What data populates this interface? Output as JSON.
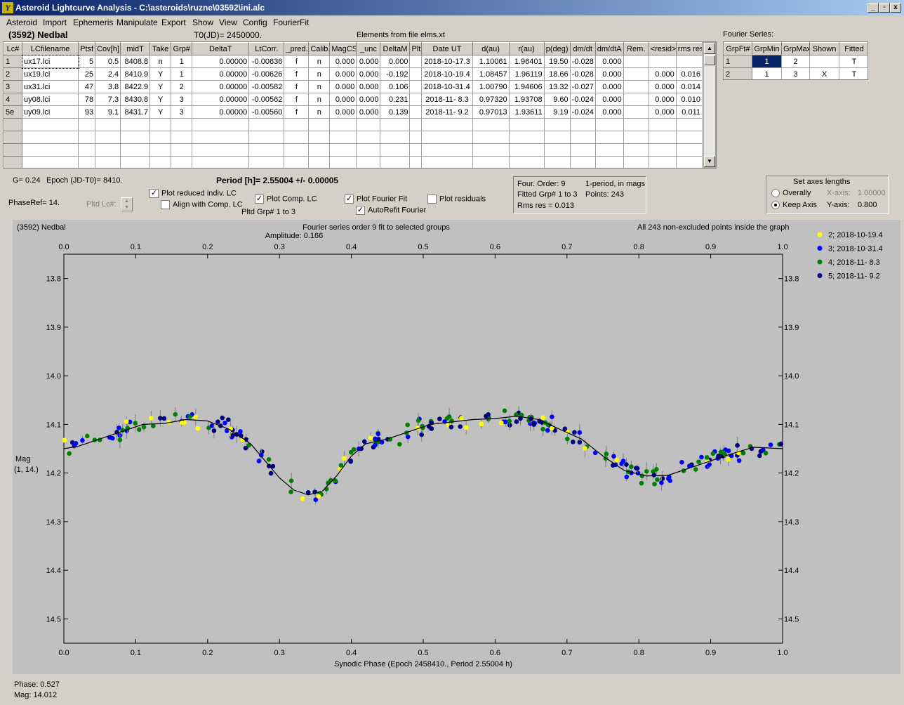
{
  "window": {
    "title": "Asteroid Lightcurve Analysis - C:\\asteroids\\ruzne\\03592\\ini.alc",
    "app_icon_glyph": "Y"
  },
  "menu": [
    "Asteroid",
    "Import",
    "Ephemeris",
    "Manipulate",
    "Export",
    "Show",
    "View",
    "Config",
    "FourierFit"
  ],
  "header": {
    "asteroid": "(3592) Nedbal",
    "t0": "T0(JD)= 2450000.",
    "elements": "Elements from file elms.xt",
    "fourier_series_label": "Fourier Series:"
  },
  "lc_table": {
    "columns": [
      "Lc#",
      "LCfilename",
      "Ptsf",
      "Cov[h]",
      "midT",
      "Take",
      "Grp#",
      "DeltaT",
      "LtCorr.",
      "_pred.",
      "Calib.",
      "MagCS",
      "_unc",
      "DeltaM",
      "Plt",
      "Date UT",
      "d(au)",
      "r(au)",
      "p(deg)",
      "dm/dt",
      "dm/dtA",
      "Rem.",
      "<resid>",
      "rms res"
    ],
    "rows": [
      [
        "1",
        "ux17.lci",
        "5",
        "0.5",
        "8408.8",
        "n",
        "1",
        "0.00000",
        "-0.00636",
        "f",
        "n",
        "0.000",
        "0.000",
        "0.000",
        "",
        "2018-10-17.3",
        "1.10061",
        "1.96401",
        "19.50",
        "-0.028",
        "0.000",
        "",
        "",
        ""
      ],
      [
        "2",
        "ux19.lci",
        "25",
        "2.4",
        "8410.9",
        "Y",
        "1",
        "0.00000",
        "-0.00626",
        "f",
        "n",
        "0.000",
        "0.000",
        "-0.192",
        "",
        "2018-10-19.4",
        "1.08457",
        "1.96119",
        "18.66",
        "-0.028",
        "0.000",
        "",
        "0.000",
        "0.016"
      ],
      [
        "3",
        "ux31.lci",
        "47",
        "3.8",
        "8422.9",
        "Y",
        "2",
        "0.00000",
        "-0.00582",
        "f",
        "n",
        "0.000",
        "0.000",
        "0.106",
        "",
        "2018-10-31.4",
        "1.00790",
        "1.94606",
        "13.32",
        "-0.027",
        "0.000",
        "",
        "0.000",
        "0.014"
      ],
      [
        "4",
        "uy08.lci",
        "78",
        "7.3",
        "8430.8",
        "Y",
        "3",
        "0.00000",
        "-0.00562",
        "f",
        "n",
        "0.000",
        "0.000",
        "0.231",
        "",
        "2018-11- 8.3",
        "0.97320",
        "1.93708",
        "9.60",
        "-0.024",
        "0.000",
        "",
        "0.000",
        "0.010"
      ],
      [
        "5e",
        "uy09.lci",
        "93",
        "9.1",
        "8431.7",
        "Y",
        "3",
        "0.00000",
        "-0.00560",
        "f",
        "n",
        "0.000",
        "0.000",
        "0.139",
        "",
        "2018-11- 9.2",
        "0.97013",
        "1.93611",
        "9.19",
        "-0.024",
        "0.000",
        "",
        "0.000",
        "0.011"
      ]
    ],
    "empty_rows": 4
  },
  "fourier_table": {
    "columns": [
      "GrpFt#",
      "GrpMin",
      "GrpMax",
      "Shown",
      "Fitted"
    ],
    "rows": [
      [
        "1",
        "1",
        "2",
        "",
        "T"
      ],
      [
        "2",
        "1",
        "3",
        "X",
        "T"
      ]
    ]
  },
  "controls": {
    "g": "G= 0.24",
    "epoch": "Epoch (JD-T0)= 8410.",
    "period": "Period [h]= 2.55004 +/- 0.00005",
    "phaseref": "PhaseRef= 14.",
    "pltd_lc": "Pltd Lc#:",
    "plot_reduced": "Plot reduced indiv. LC",
    "align_comp": "Align with Comp. LC",
    "plot_comp": "Plot Comp. LC",
    "pltd_grp": "Pltd Grp#  1   to   3",
    "plot_fourier": "Plot Fourier Fit",
    "autorefit": "AutoRefit Fourier",
    "plot_residuals": "Plot residuals",
    "four_order": "Four. Order:  9",
    "one_period": "1-period, in mags",
    "fitted_grp": "Fitted Grp# 1 to 3",
    "points": "Points: 243",
    "rms_res": "Rms res     = 0.013",
    "axes_title": "Set axes lengths",
    "overally": "Overally",
    "keep_axis": "Keep Axis",
    "x_axis_label": "X-axis:",
    "x_axis_val": "1.00000",
    "y_axis_label": "Y-axis:",
    "y_axis_val": "0.800"
  },
  "chart_data": {
    "type": "scatter",
    "title_left": "(3592) Nedbal",
    "title_center": "Fourier series order 9 fit to selected groups",
    "subtitle": "Amplitude: 0.166",
    "note_right": "All 243 non-excluded points inside the graph",
    "xlabel": "Synodic Phase (Epoch 2458410., Period 2.55004 h)",
    "ylabel": [
      "Mag",
      "(1, 14.)"
    ],
    "xlim": [
      0.0,
      1.0
    ],
    "ylim": [
      14.55,
      13.75
    ],
    "xticks": [
      "0.0",
      "0.1",
      "0.2",
      "0.3",
      "0.4",
      "0.5",
      "0.6",
      "0.7",
      "0.8",
      "0.9",
      "1.0"
    ],
    "yticks": [
      "13.8",
      "13.9",
      "14.0",
      "14.1",
      "14.2",
      "14.3",
      "14.4",
      "14.5"
    ],
    "fit_curve": {
      "x": [
        0.0,
        0.02,
        0.05,
        0.08,
        0.11,
        0.14,
        0.17,
        0.2,
        0.23,
        0.26,
        0.28,
        0.3,
        0.32,
        0.34,
        0.36,
        0.38,
        0.4,
        0.42,
        0.45,
        0.48,
        0.51,
        0.54,
        0.57,
        0.6,
        0.63,
        0.66,
        0.69,
        0.72,
        0.75,
        0.78,
        0.81,
        0.84,
        0.87,
        0.9,
        0.93,
        0.96,
        1.0
      ],
      "y": [
        14.15,
        14.145,
        14.13,
        14.115,
        14.1,
        14.098,
        14.09,
        14.093,
        14.11,
        14.14,
        14.175,
        14.21,
        14.235,
        14.245,
        14.237,
        14.205,
        14.165,
        14.14,
        14.13,
        14.115,
        14.1,
        14.095,
        14.09,
        14.088,
        14.083,
        14.09,
        14.11,
        14.13,
        14.165,
        14.195,
        14.206,
        14.205,
        14.19,
        14.175,
        14.16,
        14.147,
        14.15
      ]
    },
    "series": [
      {
        "name": "2; 2018-10-19.4",
        "color": "#ffff00"
      },
      {
        "name": "3; 2018-10-31.4",
        "color": "#0000ff"
      },
      {
        "name": "4; 2018-11- 8.3",
        "color": "#008000"
      },
      {
        "name": "5; 2018-11- 9.2",
        "color": "#000080"
      }
    ],
    "grid": false,
    "legend": "right"
  },
  "status": {
    "phase": "Phase:  0.527",
    "mag": "Mag:    14.012"
  }
}
